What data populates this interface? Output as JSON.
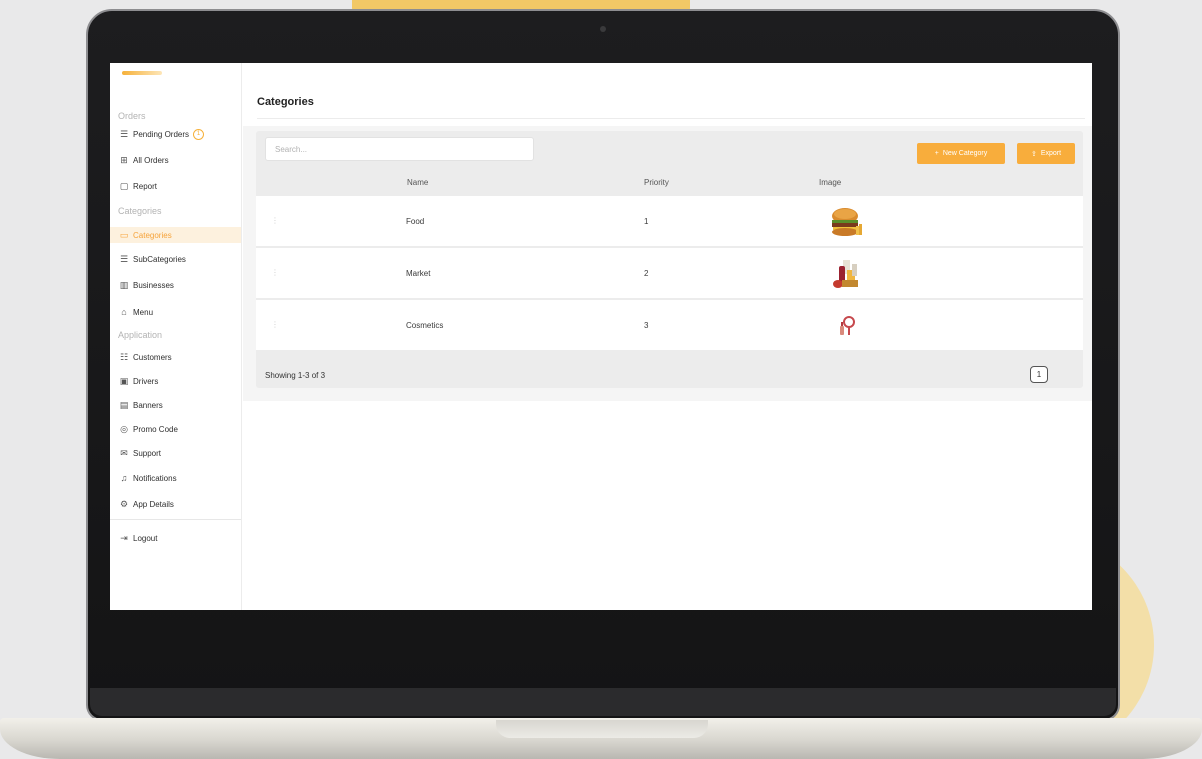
{
  "sidebar": {
    "sections": {
      "orders": "Orders",
      "categories": "Categories",
      "application": "Application"
    },
    "items": {
      "pending_orders": {
        "label": "Pending Orders",
        "badge": "1",
        "icon": "list-icon"
      },
      "all_orders": {
        "label": "All Orders",
        "icon": "grid-icon"
      },
      "report": {
        "label": "Report",
        "icon": "file-icon"
      },
      "categories": {
        "label": "Categories",
        "icon": "tag-icon",
        "active": true
      },
      "subcategories": {
        "label": "SubCategories",
        "icon": "list-icon"
      },
      "businesses": {
        "label": "Businesses",
        "icon": "building-icon"
      },
      "menu": {
        "label": "Menu",
        "icon": "bag-icon"
      },
      "customers": {
        "label": "Customers",
        "icon": "users-icon"
      },
      "drivers": {
        "label": "Drivers",
        "icon": "car-icon"
      },
      "banners": {
        "label": "Banners",
        "icon": "image-icon"
      },
      "promo_code": {
        "label": "Promo Code",
        "icon": "percent-icon"
      },
      "support": {
        "label": "Support",
        "icon": "mail-icon"
      },
      "notifications": {
        "label": "Notifications",
        "icon": "bell-icon"
      },
      "app_details": {
        "label": "App Details",
        "icon": "gear-icon"
      },
      "logout": {
        "label": "Logout",
        "icon": "logout-icon"
      }
    }
  },
  "main": {
    "title": "Categories",
    "search": {
      "placeholder": "Search...",
      "value": ""
    },
    "buttons": {
      "new_category": "New Category",
      "export": "Export"
    },
    "table": {
      "headers": {
        "name": "Name",
        "priority": "Priority",
        "image": "Image"
      },
      "rows": [
        {
          "name": "Food",
          "priority": "1",
          "image": "burger-image"
        },
        {
          "name": "Market",
          "priority": "2",
          "image": "groceries-image"
        },
        {
          "name": "Cosmetics",
          "priority": "3",
          "image": "cosmetics-image"
        }
      ]
    },
    "footer": {
      "showing": "Showing 1-3 of 3",
      "page": "1"
    }
  },
  "colors": {
    "accent": "#f8ad3c",
    "active_bg": "#fdf1de",
    "panel_bg": "#ececec"
  }
}
